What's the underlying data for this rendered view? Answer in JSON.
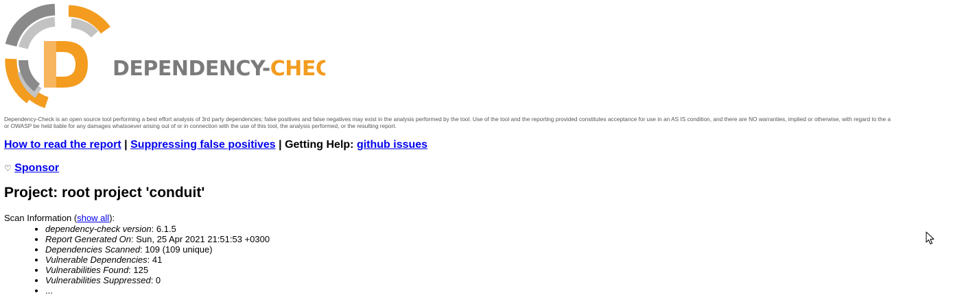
{
  "brand": {
    "logo_text_left": "DEPENDENCY-",
    "logo_text_right": "CHECK",
    "logo_letter": "D",
    "colors": {
      "orange": "#f39c1f",
      "orange_light": "#f7b55e",
      "gray_dark": "#8a8a8a",
      "gray_light": "#c3c3c3",
      "text_gray": "#7b7b7b"
    }
  },
  "disclaimer": {
    "line1": "Dependency-Check is an open source tool performing a best effort analysis of 3rd party dependencies; false positives and false negatives may exist in the analysis performed by the tool. Use of the tool and the reporting provided constitutes acceptance for use in an AS IS condition, and there are NO warranties, implied or otherwise, with regard to the a",
    "line2": "or OWASP be held liable for any damages whatsoever arising out of or in connection with the use of this tool, the analysis performed, or the resulting report."
  },
  "links": {
    "how_to_read": "How to read the report",
    "separator1": " | ",
    "suppressing": "Suppressing false positives",
    "separator2": " | ",
    "getting_help_label": "Getting Help: ",
    "github_issues": "github issues"
  },
  "sponsor": {
    "icon": "heart-icon",
    "icon_glyph": "♡",
    "label": "Sponsor"
  },
  "project": {
    "title": "Project: root project 'conduit'"
  },
  "scan_info": {
    "label": "Scan Information (",
    "show_all": "show all",
    "label_end": "):",
    "items": [
      {
        "key": "dependency-check version",
        "value": ": 6.1.5"
      },
      {
        "key": "Report Generated On",
        "value": ": Sun, 25 Apr 2021 21:51:53 +0300"
      },
      {
        "key": "Dependencies Scanned",
        "value": ": 109 (109 unique)"
      },
      {
        "key": "Vulnerable Dependencies",
        "value": ": 41"
      },
      {
        "key": "Vulnerabilities Found",
        "value": ": 125"
      },
      {
        "key": "Vulnerabilities Suppressed",
        "value": ": 0"
      },
      {
        "key": "",
        "value": "..."
      }
    ]
  }
}
